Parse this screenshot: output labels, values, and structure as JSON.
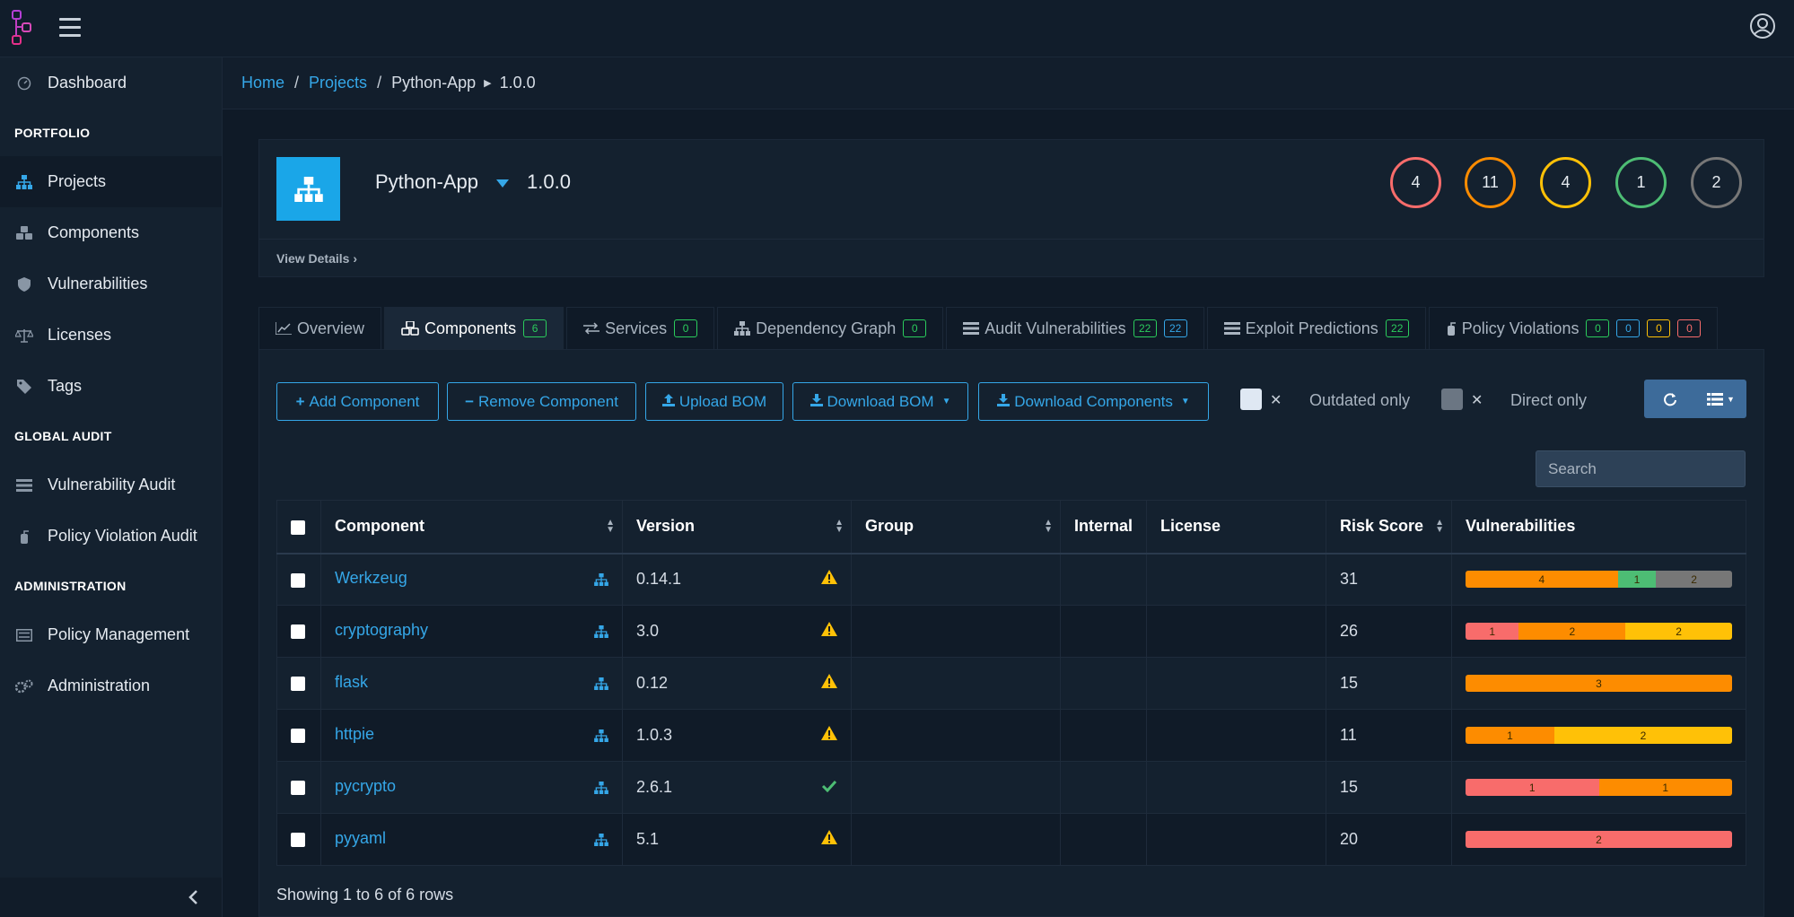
{
  "header": {
    "logo": "dependency-track-logo",
    "menu_icon": "hamburger-icon",
    "profile_icon": "user-circle-icon"
  },
  "sidebar": {
    "items": [
      {
        "label": "Dashboard",
        "icon": "speedometer-icon"
      },
      {
        "section": "PORTFOLIO"
      },
      {
        "label": "Projects",
        "icon": "sitemap-icon",
        "active": true
      },
      {
        "label": "Components",
        "icon": "cubes-icon"
      },
      {
        "label": "Vulnerabilities",
        "icon": "shield-icon"
      },
      {
        "label": "Licenses",
        "icon": "balance-scale-icon"
      },
      {
        "label": "Tags",
        "icon": "tag-icon"
      },
      {
        "section": "GLOBAL AUDIT"
      },
      {
        "label": "Vulnerability Audit",
        "icon": "tasks-icon"
      },
      {
        "label": "Policy Violation Audit",
        "icon": "fire-extinguisher-icon"
      },
      {
        "section": "ADMINISTRATION"
      },
      {
        "label": "Policy Management",
        "icon": "list-alt-icon"
      },
      {
        "label": "Administration",
        "icon": "cogs-icon"
      }
    ]
  },
  "breadcrumb": {
    "home": "Home",
    "projects": "Projects",
    "project": "Python-App",
    "version": "1.0.0"
  },
  "project": {
    "name": "Python-App",
    "version": "1.0.0",
    "view_details": "View Details",
    "severity_counts": [
      {
        "label": "critical",
        "value": "4",
        "color": "#f86c6b"
      },
      {
        "label": "high",
        "value": "11",
        "color": "#fd8c00"
      },
      {
        "label": "medium",
        "value": "4",
        "color": "#ffc107"
      },
      {
        "label": "low",
        "value": "1",
        "color": "#4dbd74"
      },
      {
        "label": "unassigned",
        "value": "2",
        "color": "#777777"
      }
    ]
  },
  "tabs": [
    {
      "label": "Overview",
      "icon": "line-chart-icon"
    },
    {
      "label": "Components",
      "icon": "cubes-icon",
      "active": true,
      "badges": [
        {
          "v": "6",
          "c": "green"
        }
      ]
    },
    {
      "label": "Services",
      "icon": "exchange-icon",
      "badges": [
        {
          "v": "0",
          "c": "green"
        }
      ]
    },
    {
      "label": "Dependency Graph",
      "icon": "sitemap-icon",
      "badges": [
        {
          "v": "0",
          "c": "green"
        }
      ]
    },
    {
      "label": "Audit Vulnerabilities",
      "icon": "tasks-icon",
      "badges": [
        {
          "v": "22",
          "c": "green"
        },
        {
          "v": "22",
          "c": "blue"
        }
      ]
    },
    {
      "label": "Exploit Predictions",
      "icon": "tasks-icon",
      "badges": [
        {
          "v": "22",
          "c": "green"
        }
      ]
    },
    {
      "label": "Policy Violations",
      "icon": "fire-extinguisher-icon",
      "badges": [
        {
          "v": "0",
          "c": "green"
        },
        {
          "v": "0",
          "c": "blue"
        },
        {
          "v": "0",
          "c": "yellow"
        },
        {
          "v": "0",
          "c": "red"
        }
      ]
    }
  ],
  "toolbar": {
    "add_component": "Add Component",
    "remove_component": "Remove Component",
    "upload_bom": "Upload BOM",
    "download_bom": "Download BOM",
    "download_components": "Download Components",
    "outdated_only": "Outdated only",
    "direct_only": "Direct only",
    "search_placeholder": "Search"
  },
  "table": {
    "columns": [
      "Component",
      "Version",
      "Group",
      "Internal",
      "License",
      "Risk Score",
      "Vulnerabilities"
    ],
    "rows": [
      {
        "component": "Werkzeug",
        "version": "0.14.1",
        "status": "warning",
        "group": "",
        "internal": "",
        "license": "",
        "risk": "31",
        "vulns": [
          {
            "sev": "high",
            "count": 4
          },
          {
            "sev": "low",
            "count": 1
          },
          {
            "sev": "unassigned",
            "count": 2
          }
        ]
      },
      {
        "component": "cryptography",
        "version": "3.0",
        "status": "warning",
        "group": "",
        "internal": "",
        "license": "",
        "risk": "26",
        "vulns": [
          {
            "sev": "critical",
            "count": 1
          },
          {
            "sev": "high",
            "count": 2
          },
          {
            "sev": "medium",
            "count": 2
          }
        ]
      },
      {
        "component": "flask",
        "version": "0.12",
        "status": "warning",
        "group": "",
        "internal": "",
        "license": "",
        "risk": "15",
        "vulns": [
          {
            "sev": "high",
            "count": 3
          }
        ]
      },
      {
        "component": "httpie",
        "version": "1.0.3",
        "status": "warning",
        "group": "",
        "internal": "",
        "license": "",
        "risk": "11",
        "vulns": [
          {
            "sev": "high",
            "count": 1
          },
          {
            "sev": "medium",
            "count": 2
          }
        ]
      },
      {
        "component": "pycrypto",
        "version": "2.6.1",
        "status": "ok",
        "group": "",
        "internal": "",
        "license": "",
        "risk": "15",
        "vulns": [
          {
            "sev": "critical",
            "count": 1
          },
          {
            "sev": "high",
            "count": 1
          }
        ]
      },
      {
        "component": "pyyaml",
        "version": "5.1",
        "status": "warning",
        "group": "",
        "internal": "",
        "license": "",
        "risk": "20",
        "vulns": [
          {
            "sev": "critical",
            "count": 2
          }
        ]
      }
    ],
    "footer": "Showing 1 to 6 of 6 rows"
  },
  "colors": {
    "accent": "#35a7e8",
    "critical": "#f86c6b",
    "high": "#fd8c00",
    "medium": "#ffc107",
    "low": "#4dbd74",
    "unassigned": "#777777"
  }
}
